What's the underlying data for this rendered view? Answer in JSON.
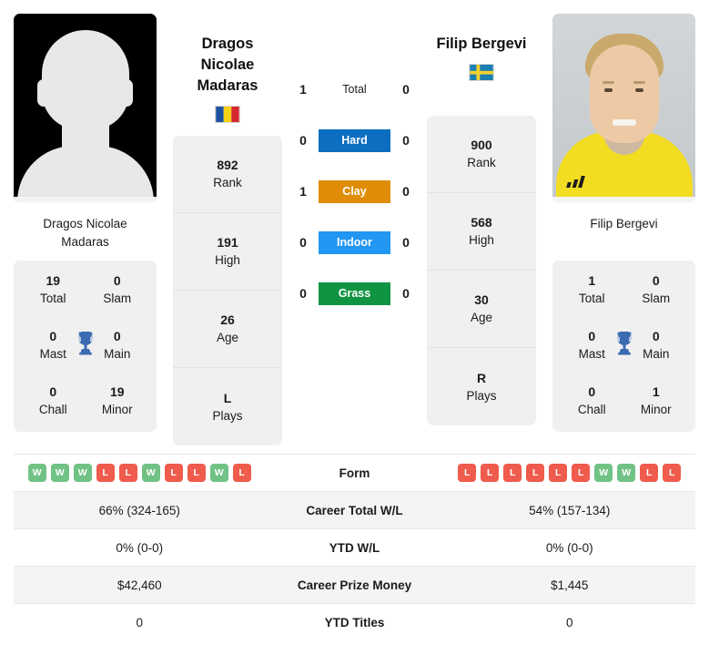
{
  "players": {
    "left": {
      "name": "Dragos Nicolae Madaras",
      "name_line1": "Dragos Nicolae",
      "name_line2": "Madaras",
      "photo_caption_line1": "Dragos Nicolae",
      "photo_caption_line2": "Madaras",
      "country": "Romania",
      "flag_icon": "romania-flag-icon",
      "photo_type": "placeholder-avatar",
      "titles": {
        "total_value": "19",
        "total_label": "Total",
        "slam_value": "0",
        "slam_label": "Slam",
        "mast_value": "0",
        "mast_label": "Mast",
        "main_value": "0",
        "main_label": "Main",
        "chall_value": "0",
        "chall_label": "Chall",
        "minor_value": "19",
        "minor_label": "Minor",
        "trophy_icon": "trophy-icon"
      },
      "stats": [
        {
          "value": "892",
          "label": "Rank"
        },
        {
          "value": "191",
          "label": "High"
        },
        {
          "value": "26",
          "label": "Age"
        },
        {
          "value": "L",
          "label": "Plays"
        }
      ],
      "form": [
        "W",
        "W",
        "W",
        "L",
        "L",
        "W",
        "L",
        "L",
        "W",
        "L"
      ],
      "career_total_wl": "66% (324-165)",
      "ytd_wl": "0% (0-0)",
      "career_prize_money": "$42,460",
      "ytd_titles": "0"
    },
    "right": {
      "name": "Filip Bergevi",
      "name_line1": "Filip Bergevi",
      "name_line2": "",
      "photo_caption_line1": "Filip Bergevi",
      "photo_caption_line2": "",
      "country": "Sweden",
      "flag_icon": "sweden-flag-icon",
      "photo_type": "player-headshot",
      "titles": {
        "total_value": "1",
        "total_label": "Total",
        "slam_value": "0",
        "slam_label": "Slam",
        "mast_value": "0",
        "mast_label": "Mast",
        "main_value": "0",
        "main_label": "Main",
        "chall_value": "0",
        "chall_label": "Chall",
        "minor_value": "1",
        "minor_label": "Minor",
        "trophy_icon": "trophy-icon"
      },
      "stats": [
        {
          "value": "900",
          "label": "Rank"
        },
        {
          "value": "568",
          "label": "High"
        },
        {
          "value": "30",
          "label": "Age"
        },
        {
          "value": "R",
          "label": "Plays"
        }
      ],
      "form": [
        "L",
        "L",
        "L",
        "L",
        "L",
        "L",
        "W",
        "W",
        "L",
        "L"
      ],
      "career_total_wl": "54% (157-134)",
      "ytd_wl": "0% (0-0)",
      "career_prize_money": "$1,445",
      "ytd_titles": "0"
    }
  },
  "h2h": [
    {
      "label": "Total",
      "left": "1",
      "right": "0",
      "color": "transparent",
      "text_color": "#1b1b1b"
    },
    {
      "label": "Hard",
      "left": "0",
      "right": "0",
      "color": "#0b6ec0",
      "text_color": "#ffffff"
    },
    {
      "label": "Clay",
      "left": "1",
      "right": "0",
      "color": "#e08c06",
      "text_color": "#ffffff"
    },
    {
      "label": "Indoor",
      "left": "0",
      "right": "0",
      "color": "#2196f3",
      "text_color": "#ffffff"
    },
    {
      "label": "Grass",
      "left": "0",
      "right": "0",
      "color": "#119442",
      "text_color": "#ffffff"
    }
  ],
  "comparison_rows": [
    {
      "label": "Form",
      "type": "form",
      "alt": false
    },
    {
      "label": "Career Total W/L",
      "type": "text",
      "alt": true,
      "left": "66% (324-165)",
      "right": "54% (157-134)"
    },
    {
      "label": "YTD W/L",
      "type": "text",
      "alt": false,
      "left": "0% (0-0)",
      "right": "0% (0-0)"
    },
    {
      "label": "Career Prize Money",
      "type": "text",
      "alt": true,
      "left": "$42,460",
      "right": "$1,445"
    },
    {
      "label": "YTD Titles",
      "type": "text",
      "alt": false,
      "left": "0",
      "right": "0"
    }
  ],
  "colors": {
    "hard": "#0b6ec0",
    "clay": "#e08c06",
    "indoor": "#2196f3",
    "grass": "#119442",
    "win_badge": "#71c285",
    "loss_badge": "#ef5b4c",
    "card_bg": "#f0f0f0",
    "row_alt_bg": "#f4f4f4",
    "trophy": "#3b6bb0"
  }
}
